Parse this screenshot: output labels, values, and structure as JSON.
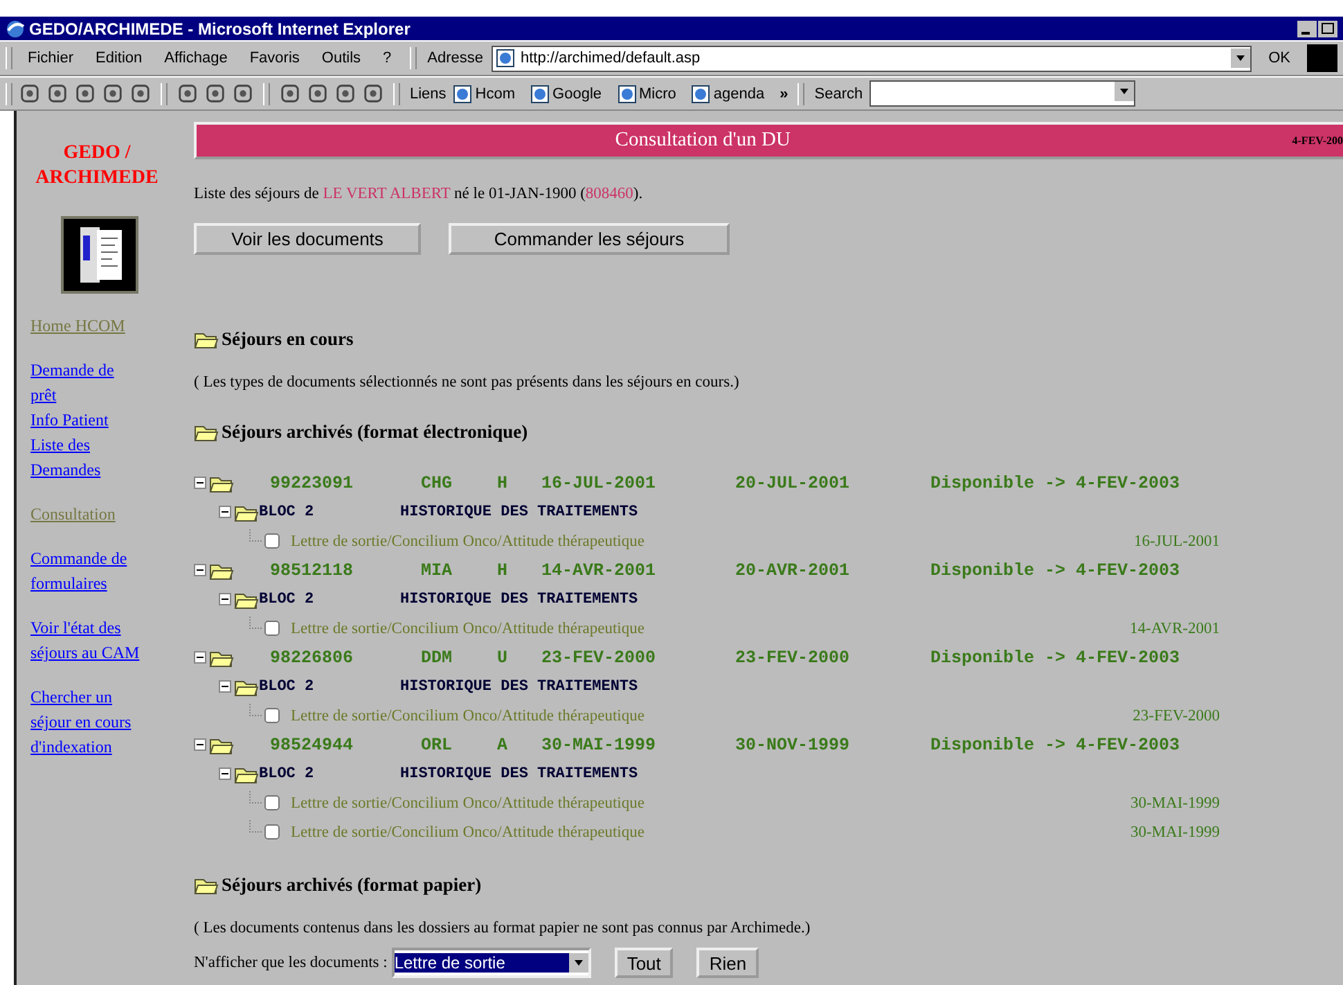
{
  "window": {
    "title": "GEDO/ARCHIMEDE - Microsoft Internet Explorer"
  },
  "menu": [
    "Fichier",
    "Edition",
    "Affichage",
    "Favoris",
    "Outils",
    "?"
  ],
  "address": {
    "label": "Adresse",
    "value": "http://archimed/default.asp",
    "go": "OK"
  },
  "links_bar": {
    "label": "Liens",
    "links": [
      "Hcom",
      "Google",
      "Micro",
      "agenda"
    ],
    "more": "»"
  },
  "search": {
    "label": "Search"
  },
  "sidebar": {
    "title_lines": [
      "GEDO /",
      "ARCHIMEDE"
    ],
    "groups": [
      [
        {
          "text": "Home HCOM",
          "visited": true
        }
      ],
      [
        {
          "text": "Demande de prêt",
          "visited": false
        },
        {
          "text": "Info Patient",
          "visited": false
        },
        {
          "text": "Liste des Demandes",
          "visited": false
        }
      ],
      [
        {
          "text": "Consultation",
          "visited": true
        }
      ],
      [
        {
          "text": "Commande de formulaires",
          "visited": false
        }
      ],
      [
        {
          "text": "Voir l'état des séjours au CAM",
          "visited": false
        }
      ],
      [
        {
          "text": "Chercher un séjour en cours d'indexation",
          "visited": false
        }
      ]
    ]
  },
  "banner": {
    "title": "Consultation d'un DU",
    "date": "4-FEV-200"
  },
  "intro": [
    {
      "text": "Liste des séjours de ",
      "highlight": false
    },
    {
      "text": "LE VERT ALBERT",
      "highlight": true
    },
    {
      "text": " né le 01-JAN-1900 (",
      "highlight": false
    },
    {
      "text": "808460",
      "highlight": true
    },
    {
      "text": ").",
      "highlight": false
    }
  ],
  "actions": [
    "Voir les documents",
    "Commander les séjours"
  ],
  "current": {
    "title": "Séjours en cours",
    "note": "( Les types de documents sélectionnés ne sont pas présents dans les séjours en cours.)"
  },
  "archived_electronic": {
    "title": "Séjours archivés (format électronique)",
    "stays": [
      {
        "id": "99223091",
        "service": "CHG",
        "type": "H",
        "admission": "16-JUL-2001",
        "discharge": "20-JUL-2001",
        "status": "Disponible -> 4-FEV-2003",
        "bloc": {
          "label": "BLOC 2",
          "title": "HISTORIQUE DES TRAITEMENTS"
        },
        "documents": [
          {
            "title": "Lettre de sortie/Concilium Onco/Attitude thérapeutique",
            "date": "16-JUL-2001",
            "checked": false
          }
        ]
      },
      {
        "id": "98512118",
        "service": "MIA",
        "type": "H",
        "admission": "14-AVR-2001",
        "discharge": "20-AVR-2001",
        "status": "Disponible -> 4-FEV-2003",
        "bloc": {
          "label": "BLOC 2",
          "title": "HISTORIQUE DES TRAITEMENTS"
        },
        "documents": [
          {
            "title": "Lettre de sortie/Concilium Onco/Attitude thérapeutique",
            "date": "14-AVR-2001",
            "checked": false
          }
        ]
      },
      {
        "id": "98226806",
        "service": "DDM",
        "type": "U",
        "admission": "23-FEV-2000",
        "discharge": "23-FEV-2000",
        "status": "Disponible -> 4-FEV-2003",
        "bloc": {
          "label": "BLOC 2",
          "title": "HISTORIQUE DES TRAITEMENTS"
        },
        "documents": [
          {
            "title": "Lettre de sortie/Concilium Onco/Attitude thérapeutique",
            "date": "23-FEV-2000",
            "checked": false
          }
        ]
      },
      {
        "id": "98524944",
        "service": "ORL",
        "type": "A",
        "admission": "30-MAI-1999",
        "discharge": "30-NOV-1999",
        "status": "Disponible -> 4-FEV-2003",
        "bloc": {
          "label": "BLOC 2",
          "title": "HISTORIQUE DES TRAITEMENTS"
        },
        "documents": [
          {
            "title": "Lettre de sortie/Concilium Onco/Attitude thérapeutique",
            "date": "30-MAI-1999",
            "checked": false
          },
          {
            "title": "Lettre de sortie/Concilium Onco/Attitude thérapeutique",
            "date": "30-MAI-1999",
            "checked": false
          }
        ]
      }
    ]
  },
  "archived_paper": {
    "title": "Séjours archivés (format papier)",
    "note": "( Les documents contenus dans les dossiers au format papier ne sont pas connus par Archimede.)",
    "filter": {
      "label": "N'afficher que les documents :",
      "value": "Lettre de sortie",
      "buttons": [
        "Tout",
        "Rien"
      ]
    }
  }
}
